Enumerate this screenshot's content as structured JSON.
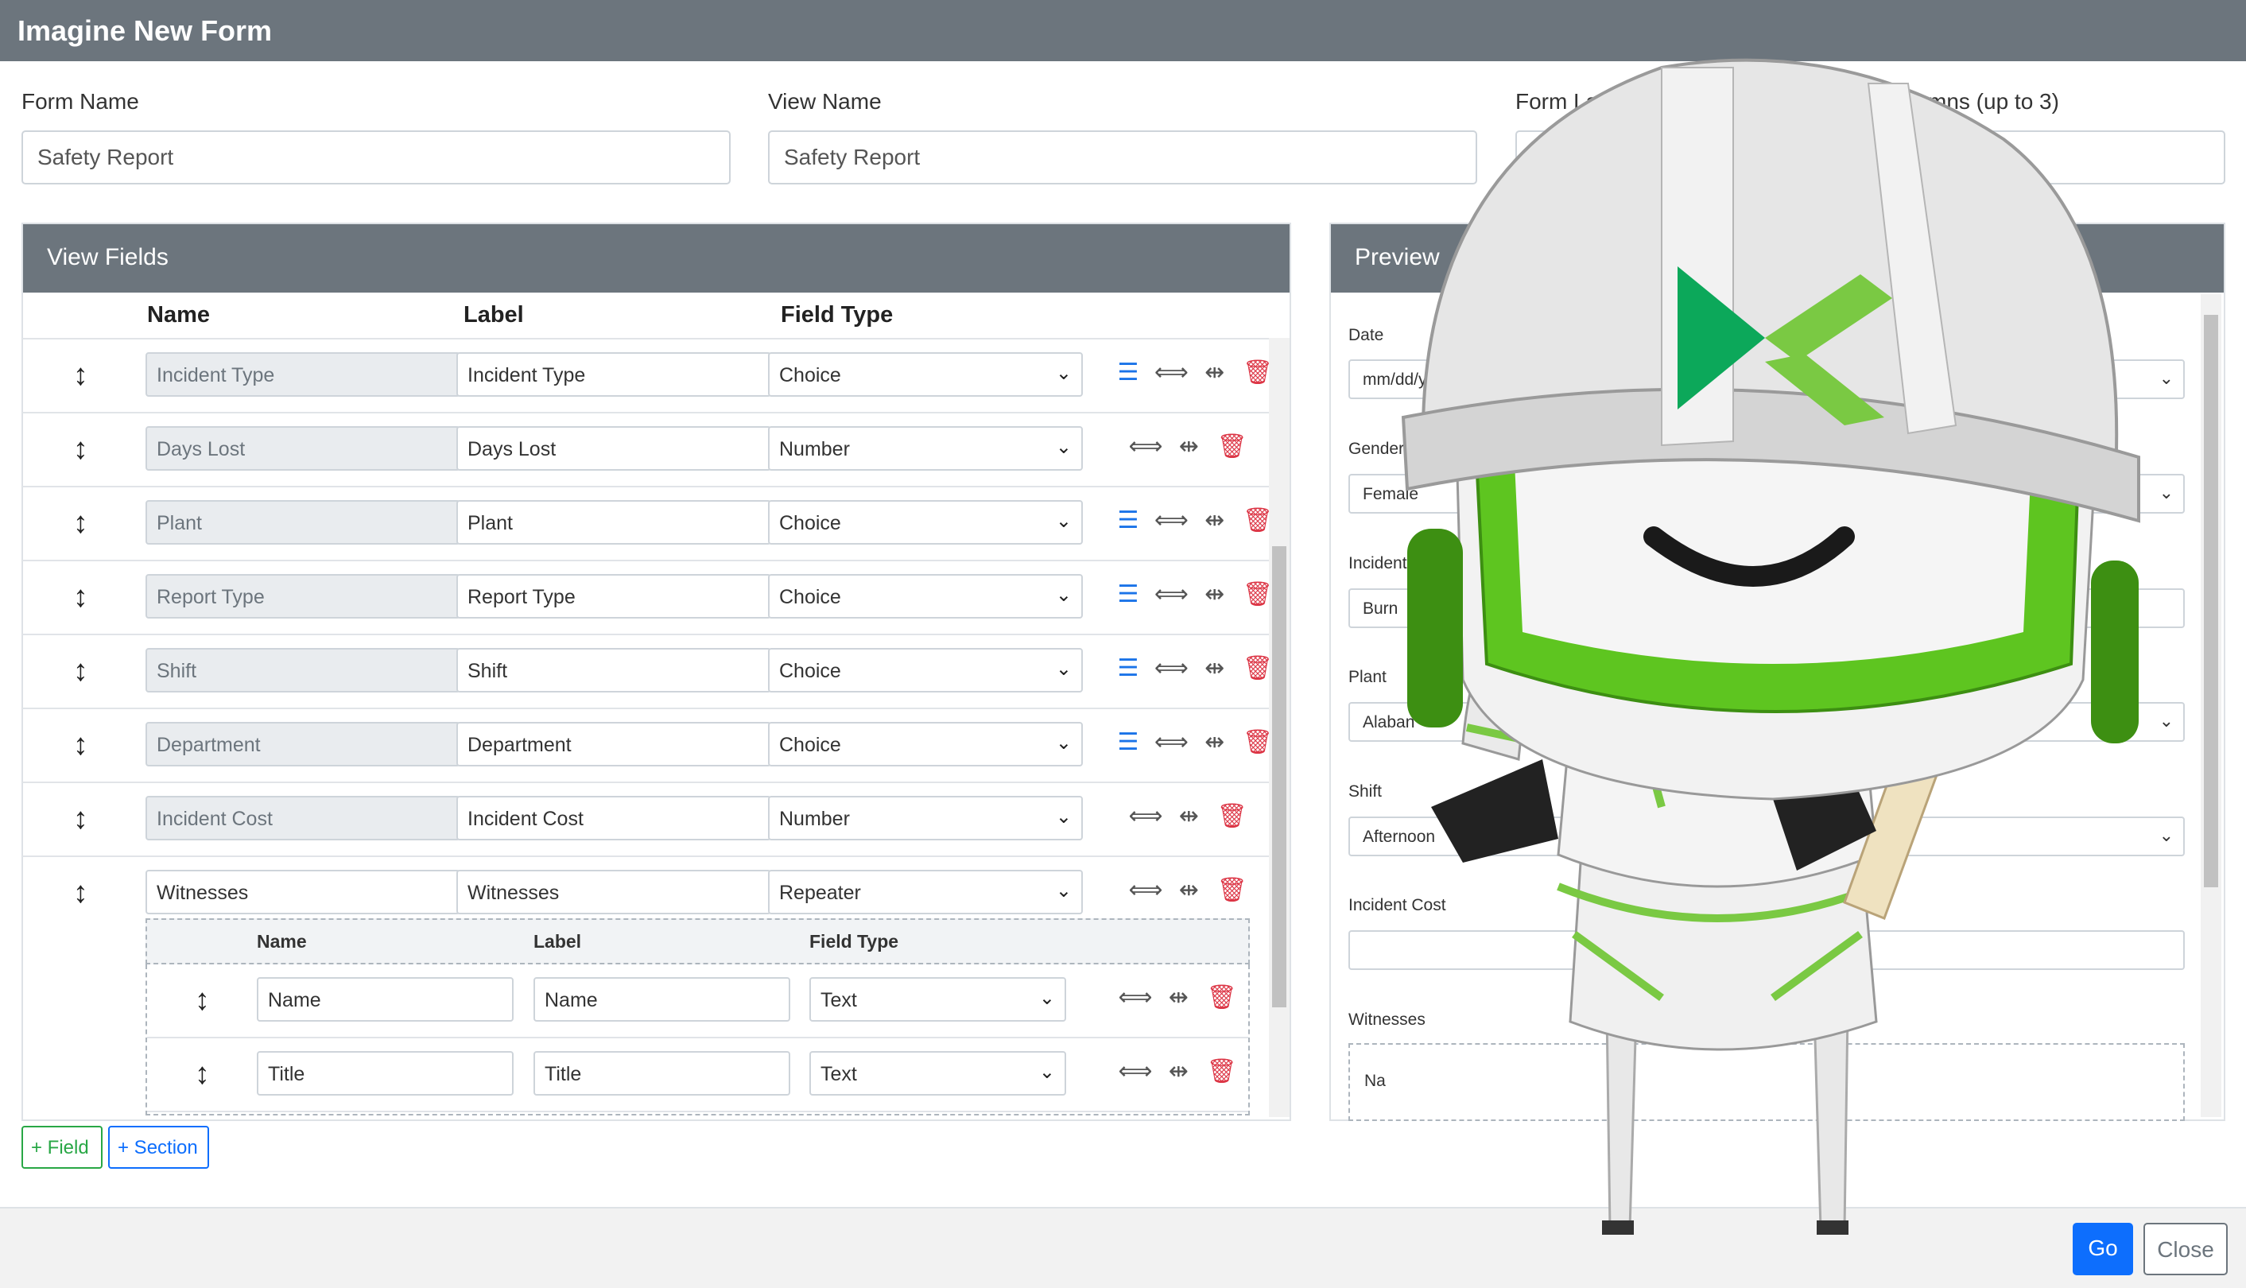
{
  "window": {
    "title": "Imagine New Form"
  },
  "form": {
    "form_name_label": "Form Name",
    "form_name_value": "Safety Report",
    "view_name_label": "View Name",
    "view_name_value": "Safety Report",
    "form_layout_label": "Form Lay",
    "columns_label": "mns (up to 3)"
  },
  "view_fields": {
    "title": "View Fields",
    "headers": {
      "name": "Name",
      "label": "Label",
      "type": "Field Type"
    },
    "rows": [
      {
        "name": "Incident Type",
        "label": "Incident Type",
        "type": "Choice"
      },
      {
        "name": "Days Lost",
        "label": "Days Lost",
        "type": "Number"
      },
      {
        "name": "Plant",
        "label": "Plant",
        "type": "Choice"
      },
      {
        "name": "Report Type",
        "label": "Report Type",
        "type": "Choice"
      },
      {
        "name": "Shift",
        "label": "Shift",
        "type": "Choice"
      },
      {
        "name": "Department",
        "label": "Department",
        "type": "Choice"
      },
      {
        "name": "Incident Cost",
        "label": "Incident Cost",
        "type": "Number"
      },
      {
        "name": "Witnesses",
        "label": "Witnesses",
        "type": "Repeater"
      }
    ],
    "sub_headers": {
      "name": "Name",
      "label": "Label",
      "type": "Field Type"
    },
    "sub_rows": [
      {
        "name": "Name",
        "label": "Name",
        "type": "Text"
      },
      {
        "name": "Title",
        "label": "Title",
        "type": "Text"
      }
    ]
  },
  "icons": {
    "drag": "↕",
    "list": "☰",
    "expand": "⟻⟼",
    "collapse": "⥇",
    "delete": "🗑"
  },
  "buttons": {
    "add_field": "+ Field",
    "add_section": "+ Section",
    "go": "Go",
    "close": "Close"
  },
  "preview": {
    "title": "Preview",
    "fields": [
      {
        "label": "Date",
        "value": "mm/dd/yyy"
      },
      {
        "label": "Gender",
        "value": "Female"
      },
      {
        "label": "Incident",
        "value": "Burn"
      },
      {
        "label": "Plant",
        "value": "Alaban"
      },
      {
        "label": "Shift",
        "value": "Afternoon"
      },
      {
        "label": "Incident Cost",
        "value": ""
      },
      {
        "label": "Witnesses",
        "value": "Na"
      }
    ]
  },
  "colors": {
    "header": "#6c757d",
    "primary": "#0d6efd",
    "success": "#28a745",
    "danger": "#dc3545",
    "mascot_green": "#7ac943"
  }
}
